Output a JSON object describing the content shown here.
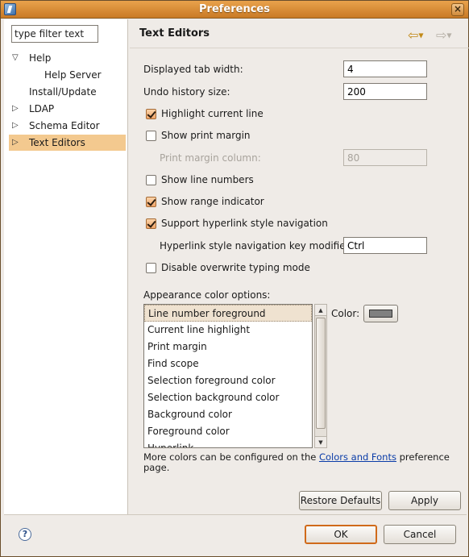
{
  "window": {
    "title": "Preferences",
    "close_glyph": "×"
  },
  "filter": {
    "value": "type filter text"
  },
  "tree": [
    {
      "label": "Help",
      "arrow": "▽",
      "indent": 0
    },
    {
      "label": "Help Server",
      "arrow": "",
      "indent": 2
    },
    {
      "label": "Install/Update",
      "arrow": "",
      "indent": 1
    },
    {
      "label": "LDAP",
      "arrow": "▷",
      "indent": 0
    },
    {
      "label": "Schema Editor",
      "arrow": "▷",
      "indent": 0
    },
    {
      "label": "Text Editors",
      "arrow": "▷",
      "indent": 0,
      "selected": true
    }
  ],
  "page": {
    "title": "Text Editors",
    "tab_width_label": "Displayed tab width:",
    "tab_width_value": "4",
    "undo_label": "Undo history size:",
    "undo_value": "200",
    "highlight_line": {
      "label": "Highlight current line",
      "checked": true
    },
    "print_margin": {
      "label": "Show print margin",
      "checked": false
    },
    "print_margin_column_label": "Print margin column:",
    "print_margin_column_value": "80",
    "line_numbers": {
      "label": "Show line numbers",
      "checked": false
    },
    "range_indicator": {
      "label": "Show range indicator",
      "checked": true
    },
    "hyperlink_nav": {
      "label": "Support hyperlink style navigation",
      "checked": true
    },
    "hyperlink_key_label": "Hyperlink style navigation key modifier:",
    "hyperlink_key_value": "Ctrl",
    "overwrite": {
      "label": "Disable overwrite typing mode",
      "checked": false
    },
    "appearance_label": "Appearance color options:",
    "color_options": [
      "Line number foreground",
      "Current line highlight",
      "Print margin",
      "Find scope",
      "Selection foreground color",
      "Selection background color",
      "Background color",
      "Foreground color",
      "Hyperlink"
    ],
    "color_label": "Color:",
    "color_value": "#808080",
    "more_text_pre": "More colors can be configured on the ",
    "more_text_link": "Colors and Fonts",
    "more_text_post": " preference page."
  },
  "buttons": {
    "restore": "Restore Defaults",
    "apply": "Apply",
    "ok": "OK",
    "cancel": "Cancel"
  },
  "icons": {
    "back": "⇦",
    "forward": "⇨",
    "help": "?"
  }
}
